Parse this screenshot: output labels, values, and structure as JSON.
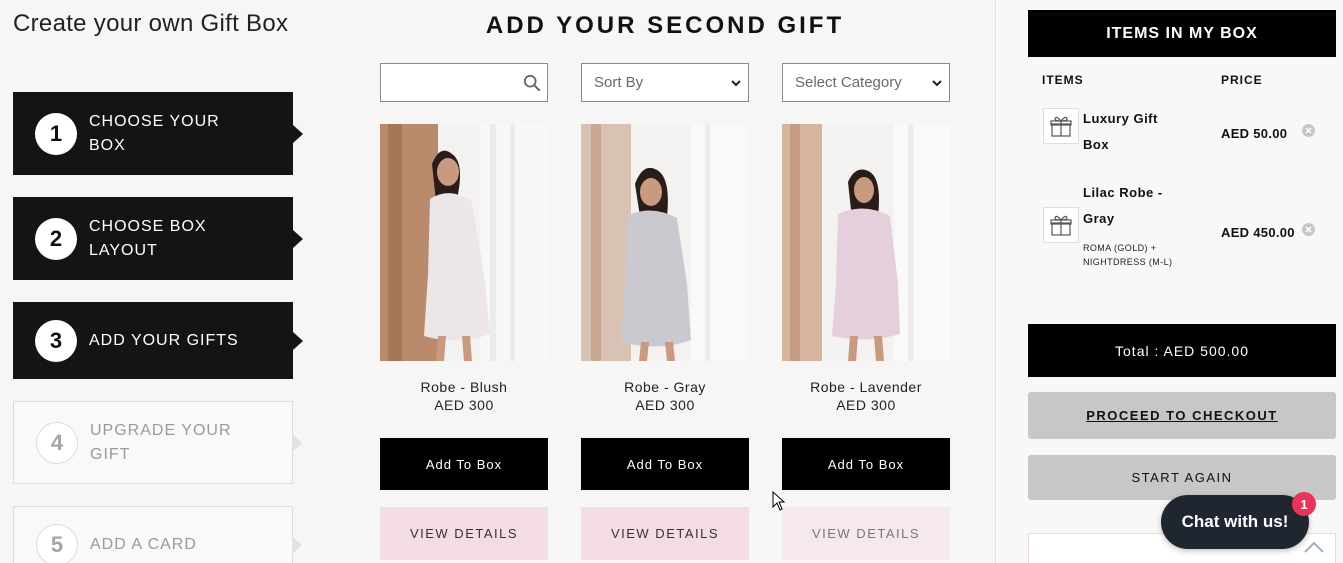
{
  "page": {
    "heading": "Create your own Gift Box"
  },
  "steps": [
    {
      "number": "1",
      "label": "CHOOSE YOUR BOX",
      "state": "active"
    },
    {
      "number": "2",
      "label": "CHOOSE BOX LAYOUT",
      "state": "active"
    },
    {
      "number": "3",
      "label": "ADD YOUR GIFTS",
      "state": "active"
    },
    {
      "number": "4",
      "label": "UPGRADE YOUR GIFT",
      "state": "inactive"
    },
    {
      "number": "5",
      "label": "ADD A CARD",
      "state": "inactive"
    }
  ],
  "catalog": {
    "title": "ADD YOUR SECOND GIFT",
    "search": {
      "value": "",
      "placeholder": ""
    },
    "sort": {
      "selected": "Sort By"
    },
    "category": {
      "selected": "Select Category"
    },
    "products": [
      {
        "name": "Robe - Blush",
        "price": "AED 300",
        "add_label": "Add To Box",
        "view_label": "VIEW DETAILS",
        "robe_color": "#ece6e8"
      },
      {
        "name": "Robe - Gray",
        "price": "AED 300",
        "add_label": "Add To Box",
        "view_label": "VIEW DETAILS",
        "robe_color": "#c9c9cf"
      },
      {
        "name": "Robe - Lavender",
        "price": "AED 300",
        "add_label": "Add To Box",
        "view_label": "VIEW DETAILS",
        "robe_color": "#e6cfdc"
      }
    ]
  },
  "cart": {
    "title": "ITEMS IN MY BOX",
    "col_items": "ITEMS",
    "col_price": "PRICE",
    "items": [
      {
        "name_line1": "Luxury Gift",
        "name_line2": "Box",
        "variant": "",
        "price": "AED 50.00"
      },
      {
        "name_line1": "Lilac Robe -",
        "name_line2": "Gray",
        "variant": "ROMA (GOLD) + NIGHTDRESS (M-L)",
        "price": "AED 450.00"
      }
    ],
    "total": "Total : AED 500.00",
    "checkout_label": "PROCEED TO CHECKOUT",
    "start_again_label": "START AGAIN"
  },
  "chat": {
    "label": "Chat with us!",
    "badge": "1"
  },
  "colors": {
    "accent_pink": "#f3dde2",
    "chat_badge": "#e8335a",
    "dark": "#000000"
  }
}
